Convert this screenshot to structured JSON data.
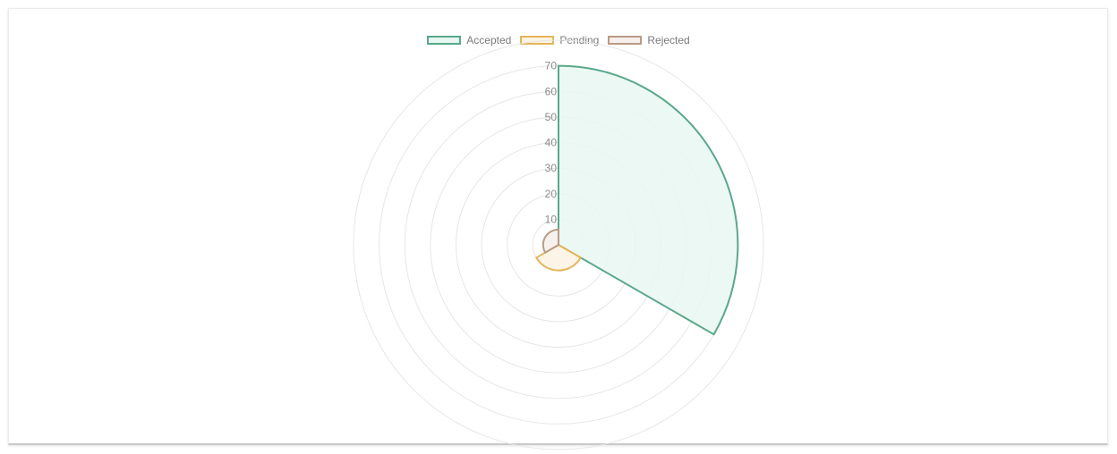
{
  "chart_data": {
    "type": "polarArea",
    "categories": [
      "Accepted",
      "Pending",
      "Rejected"
    ],
    "values": [
      70,
      10,
      6
    ],
    "colors": {
      "Accepted": {
        "border": "#5aa88a",
        "fill": "#e9f7f2"
      },
      "Pending": {
        "border": "#e5b55a",
        "fill": "#fcf3e3"
      },
      "Rejected": {
        "border": "#b99a85",
        "fill": "#f6efea"
      }
    },
    "r_ticks": [
      "10",
      "20",
      "30",
      "40",
      "50",
      "60",
      "70"
    ],
    "r_max": 80,
    "grid": true,
    "legend_position": "top"
  }
}
